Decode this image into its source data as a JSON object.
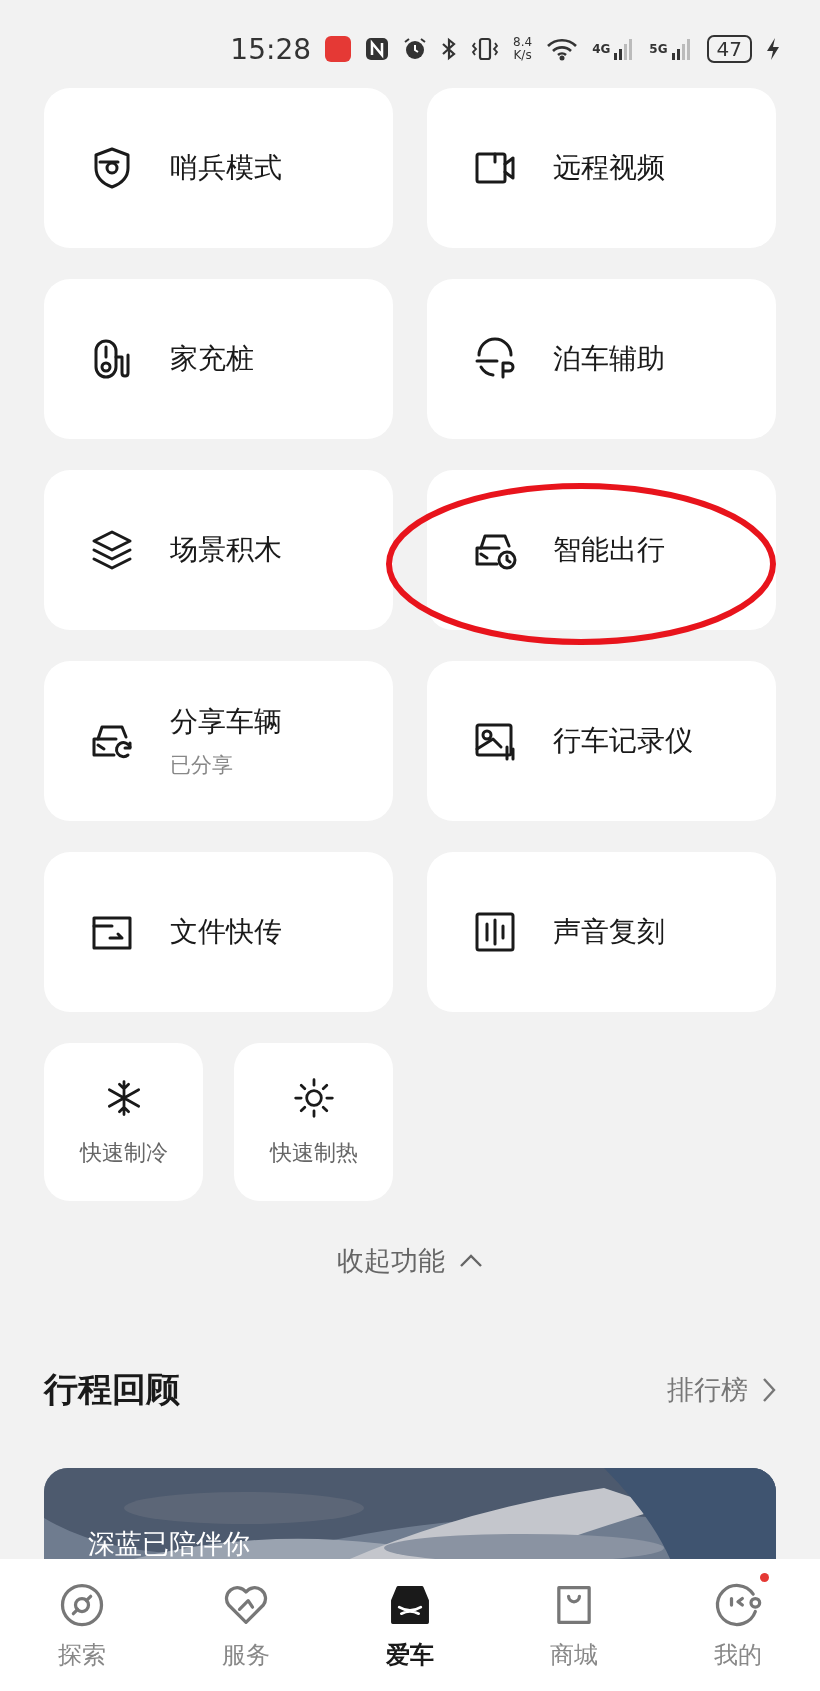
{
  "status_bar": {
    "time": "15:28",
    "speed_value": "8.4",
    "speed_unit": "K/s",
    "network_1": "4G",
    "network_2": "5G",
    "battery": "47",
    "charging": true
  },
  "features": [
    {
      "label": "哨兵模式",
      "circled": false
    },
    {
      "label": "远程视频",
      "circled": false
    },
    {
      "label": "家充桩",
      "circled": false
    },
    {
      "label": "泊车辅助",
      "circled": false
    },
    {
      "label": "场景积木",
      "circled": false
    },
    {
      "label": "智能出行",
      "circled": true
    },
    {
      "label": "分享车辆",
      "sublabel": "已分享",
      "circled": false
    },
    {
      "label": "行车记录仪",
      "circled": false
    },
    {
      "label": "文件快传",
      "circled": false
    },
    {
      "label": "声音复刻",
      "circled": false
    }
  ],
  "quick_actions": [
    {
      "label": "快速制冷"
    },
    {
      "label": "快速制热"
    }
  ],
  "collapse_button": "收起功能",
  "trip_review": {
    "title": "行程回顾",
    "link": "排行榜",
    "card": {
      "kind": "picture",
      "title": "深蓝已陪伴你"
    }
  },
  "bottom_nav": [
    {
      "label": "探索",
      "selected": false,
      "badge": false
    },
    {
      "label": "服务",
      "selected": false,
      "badge": false
    },
    {
      "label": "爱车",
      "selected": true,
      "badge": false
    },
    {
      "label": "商城",
      "selected": false,
      "badge": false
    },
    {
      "label": "我的",
      "selected": false,
      "badge": true
    }
  ]
}
